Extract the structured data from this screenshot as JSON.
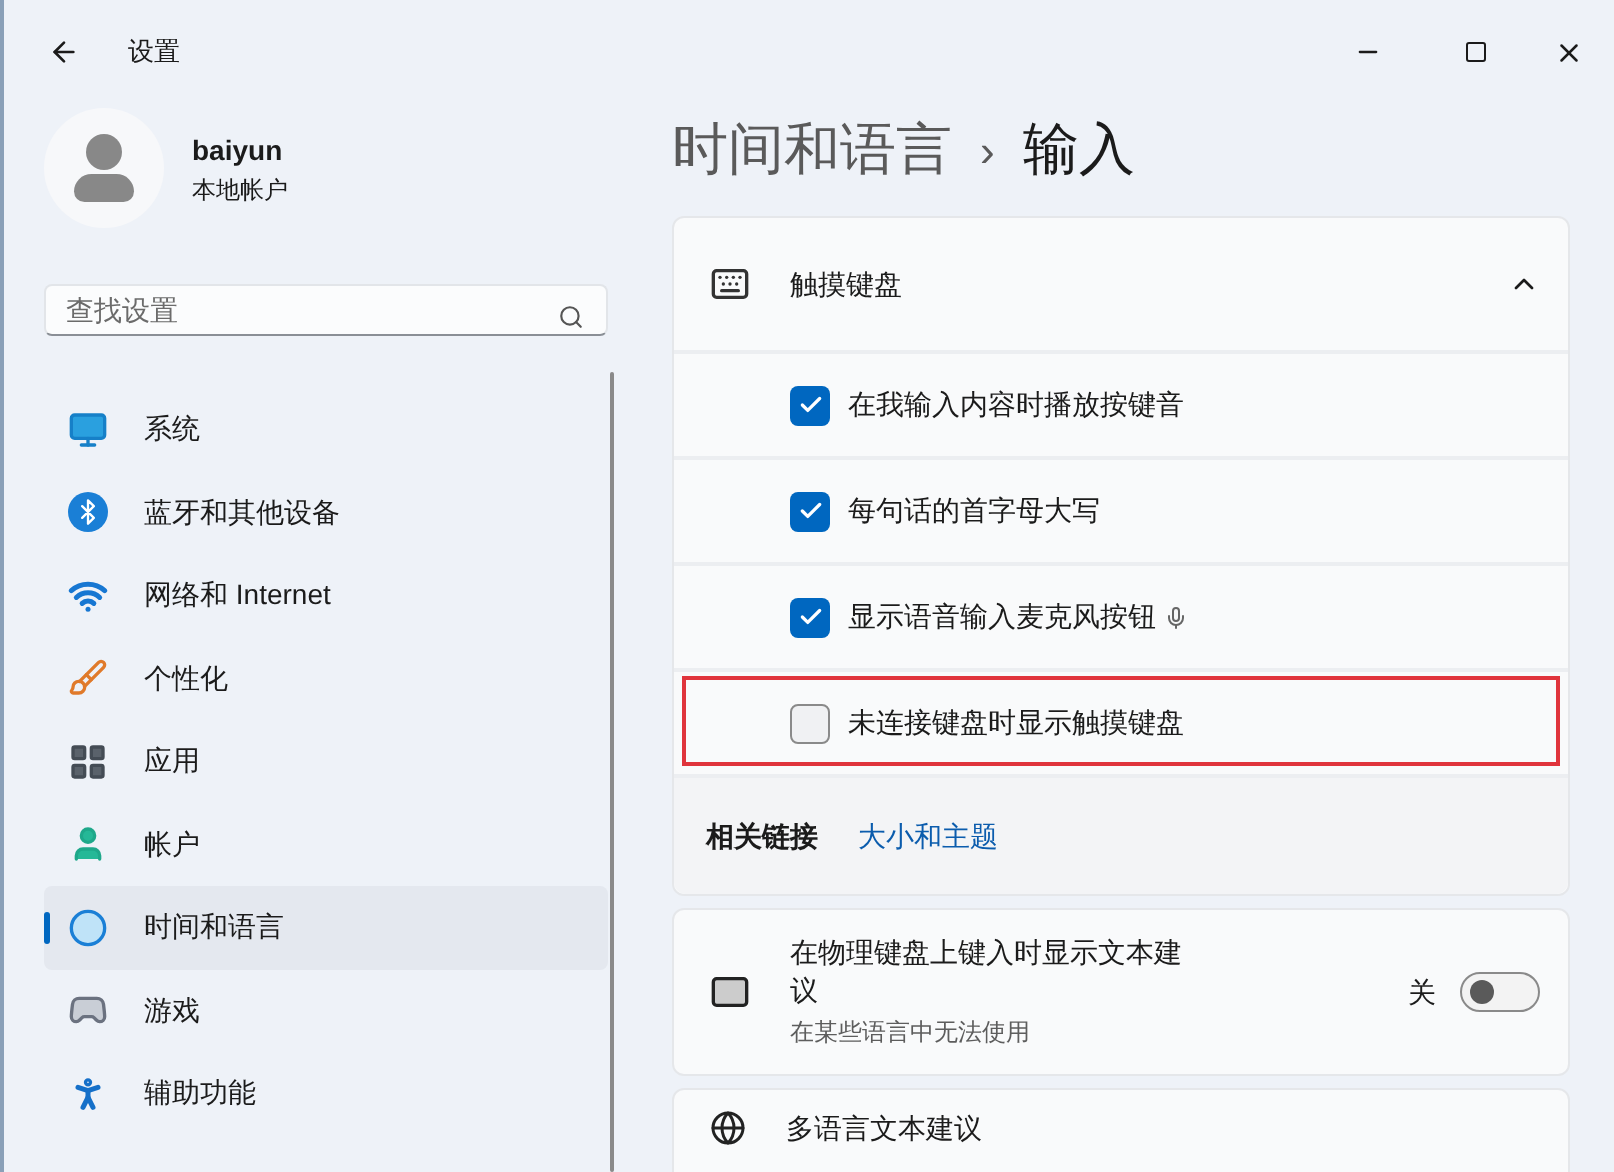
{
  "window": {
    "title": "设置"
  },
  "profile": {
    "name": "baiyun",
    "account_type": "本地帐户"
  },
  "search": {
    "placeholder": "查找设置"
  },
  "nav": [
    {
      "label": "系统",
      "selected": false
    },
    {
      "label": "蓝牙和其他设备",
      "selected": false
    },
    {
      "label": "网络和 Internet",
      "selected": false
    },
    {
      "label": "个性化",
      "selected": false
    },
    {
      "label": "应用",
      "selected": false
    },
    {
      "label": "帐户",
      "selected": false
    },
    {
      "label": "时间和语言",
      "selected": true
    },
    {
      "label": "游戏",
      "selected": false
    },
    {
      "label": "辅助功能",
      "selected": false
    }
  ],
  "breadcrumb": {
    "parent": "时间和语言",
    "separator": "›",
    "current": "输入"
  },
  "touch_keyboard": {
    "title": "触摸键盘",
    "expanded": true,
    "options": [
      {
        "label": "在我输入内容时播放按键音",
        "checked": true,
        "mic": false,
        "highlighted": false
      },
      {
        "label": "每句话的首字母大写",
        "checked": true,
        "mic": false,
        "highlighted": false
      },
      {
        "label": "显示语音输入麦克风按钮",
        "checked": true,
        "mic": true,
        "highlighted": false
      },
      {
        "label": "未连接键盘时显示触摸键盘",
        "checked": false,
        "mic": false,
        "highlighted": true
      }
    ],
    "related_label": "相关链接",
    "related_link": "大小和主题"
  },
  "settings": [
    {
      "title": "在物理键盘上键入时显示文本建议",
      "subtitle": "在某些语言中无法使用",
      "state_label": "关",
      "on": false
    },
    {
      "title": "多语言文本建议"
    }
  ]
}
